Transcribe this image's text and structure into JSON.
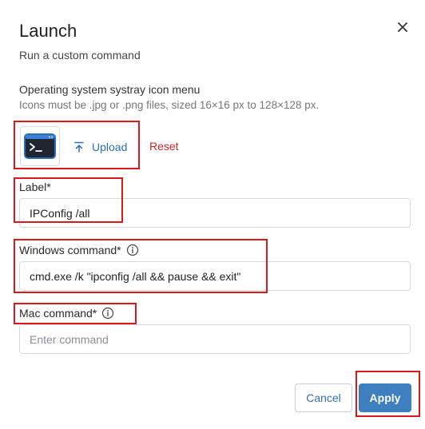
{
  "dialog": {
    "title": "Launch",
    "subtitle": "Run a custom command",
    "close_icon": "close-icon"
  },
  "os_icon": {
    "heading": "Operating system systray icon menu",
    "help": "Icons must be .jpg or .png files, sized 16×16 px to 128×128 px.",
    "preview_icon": "terminal-icon",
    "upload_label": "Upload",
    "upload_icon": "upload-icon",
    "reset_label": "Reset"
  },
  "fields": {
    "label": {
      "label": "Label*",
      "value": "IPConfig /all"
    },
    "windows_command": {
      "label": "Windows command*",
      "value": "cmd.exe /k \"ipconfig /all && pause && exit\"",
      "info_icon": "info-icon"
    },
    "mac_command": {
      "label": "Mac command*",
      "value": "",
      "placeholder": "Enter command",
      "info_icon": "info-icon"
    }
  },
  "actions": {
    "cancel_label": "Cancel",
    "apply_label": "Apply"
  },
  "colors": {
    "primary": "#3d7fbf",
    "link": "#2f6fb1",
    "danger": "#c62828",
    "highlight": "#d9191c"
  }
}
